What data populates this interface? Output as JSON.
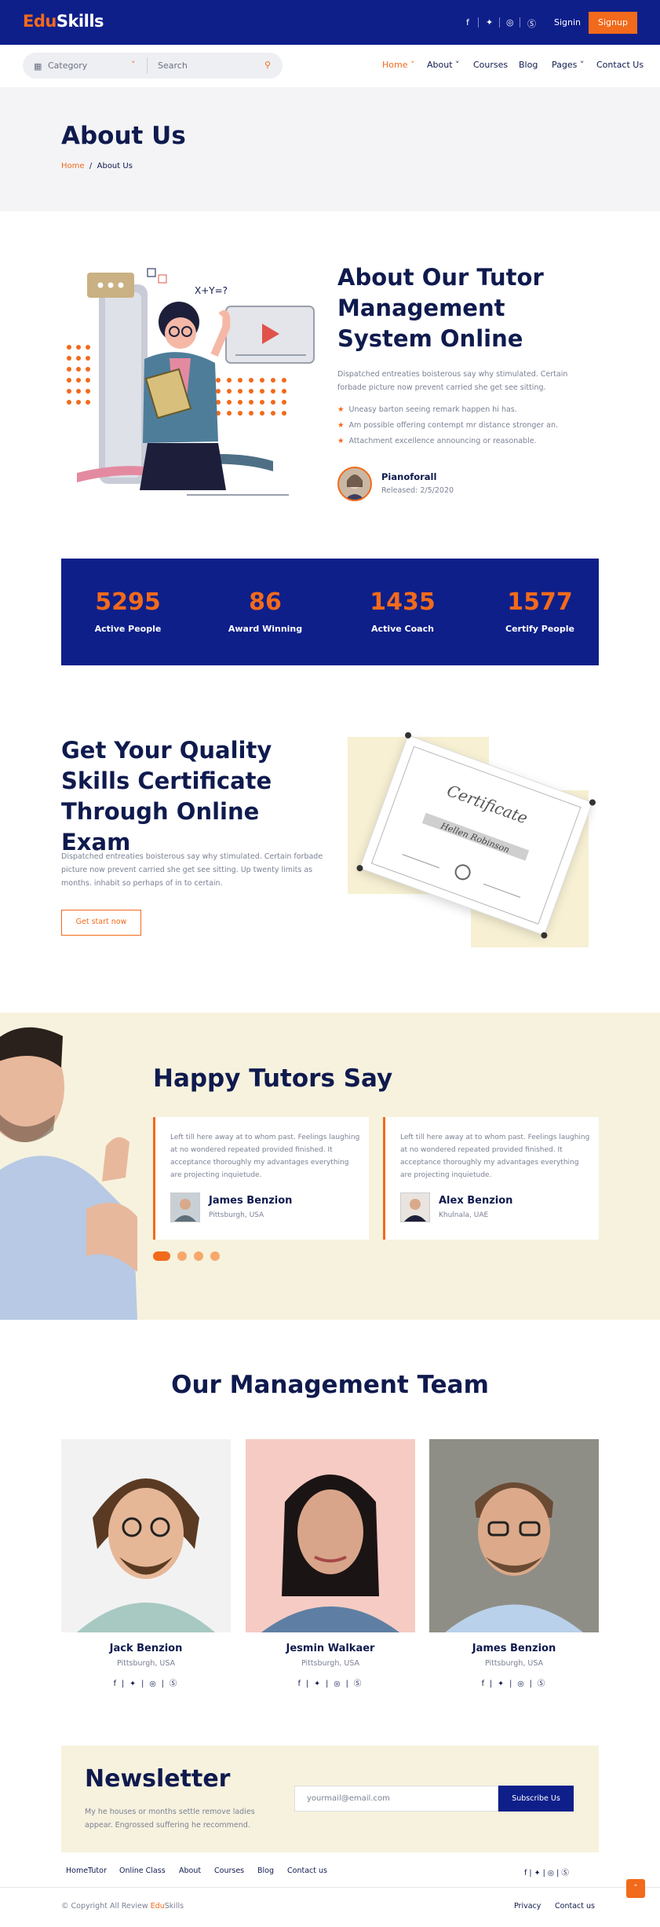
{
  "brand": {
    "logo_prefix": "Edu",
    "logo_suffix": "Skills",
    "accent": "#f26a1b",
    "navy": "#0e1f8a"
  },
  "topbar": {
    "social_icons": [
      "facebook-icon",
      "twitter-icon",
      "instagram-icon",
      "skype-icon"
    ],
    "social_glyphs": [
      "f",
      "✦",
      "◎",
      "Ⓢ"
    ],
    "signin": "Signin",
    "signup": "Signup"
  },
  "navbar": {
    "category": "Category",
    "search_placeholder": "Search",
    "links": [
      "Home",
      "About",
      "Courses",
      "Blog",
      "Pages",
      "Contact Us"
    ],
    "chevron": "˅"
  },
  "hero": {
    "title": "About Us",
    "crumb_home": "Home",
    "crumb_sep": "/",
    "crumb_current": "About Us"
  },
  "about": {
    "title": "About Our Tutor Management System Online",
    "text": "Dispatched entreaties boisterous say why stimulated. Certain forbade picture now prevent carried she get see sitting.",
    "bullets": [
      "Uneasy barton seeing remark happen hi has.",
      "Am possible offering contempt mr distance stronger an.",
      "Attachment excellence announcing or reasonable."
    ],
    "author": "Pianoforall",
    "released": "Released: 2/5/2020"
  },
  "stats": [
    {
      "value": "5295",
      "label": "Active People"
    },
    {
      "value": "86",
      "label": "Award Winning"
    },
    {
      "value": "1435",
      "label": "Active Coach"
    },
    {
      "value": "1577",
      "label": "Certify People"
    }
  ],
  "certificate": {
    "title": "Get Your Quality Skills Certificate Through Online Exam",
    "text": "Dispatched entreaties boisterous say why stimulated. Certain forbade picture now prevent carried she get see sitting. Up twenty limits as months. inhabit so perhaps of in to certain.",
    "button": "Get start now",
    "cert_heading": "Certificate",
    "cert_name": "Hellen Robinson"
  },
  "testimonials": {
    "title": "Happy Tutors Say",
    "items": [
      {
        "text": "Left till here away at to whom past. Feelings laughing at no wondered repeated provided finished. It acceptance thoroughly my advantages everything are projecting inquietude.",
        "name": "James Benzion",
        "location": "Pittsburgh, USA"
      },
      {
        "text": "Left till here away at to whom past. Feelings laughing at no wondered repeated provided finished. It acceptance thoroughly my advantages everything are projecting inquietude.",
        "name": "Alex Benzion",
        "location": "Khulnala, UAE"
      }
    ],
    "dot_count": 4
  },
  "team": {
    "title": "Our Management Team",
    "members": [
      {
        "name": "Jack Benzion",
        "location": "Pittsburgh, USA"
      },
      {
        "name": "Jesmin Walkaer",
        "location": "Pittsburgh, USA"
      },
      {
        "name": "James Benzion",
        "location": "Pittsburgh, USA"
      }
    ],
    "social": "f | ✦ | ◎ | Ⓢ"
  },
  "newsletter": {
    "title": "Newsletter",
    "text": "My he houses or months settle remove ladies appear. Engrossed suffering he recommend.",
    "placeholder": "yourmail@email.com",
    "button": "Subscribe Us"
  },
  "footer": {
    "links": [
      "HomeTutor",
      "Online Class",
      "About",
      "Courses",
      "Blog",
      "Contact us"
    ],
    "social": "f  |  ✦  |  ◎  |  Ⓢ",
    "copyright_prefix": "© Copyright All Review ",
    "copyright_brand_a": "Edu",
    "copyright_brand_b": "Skills",
    "privacy": "Privacy",
    "contact": "Contact us",
    "totop": "˄"
  }
}
